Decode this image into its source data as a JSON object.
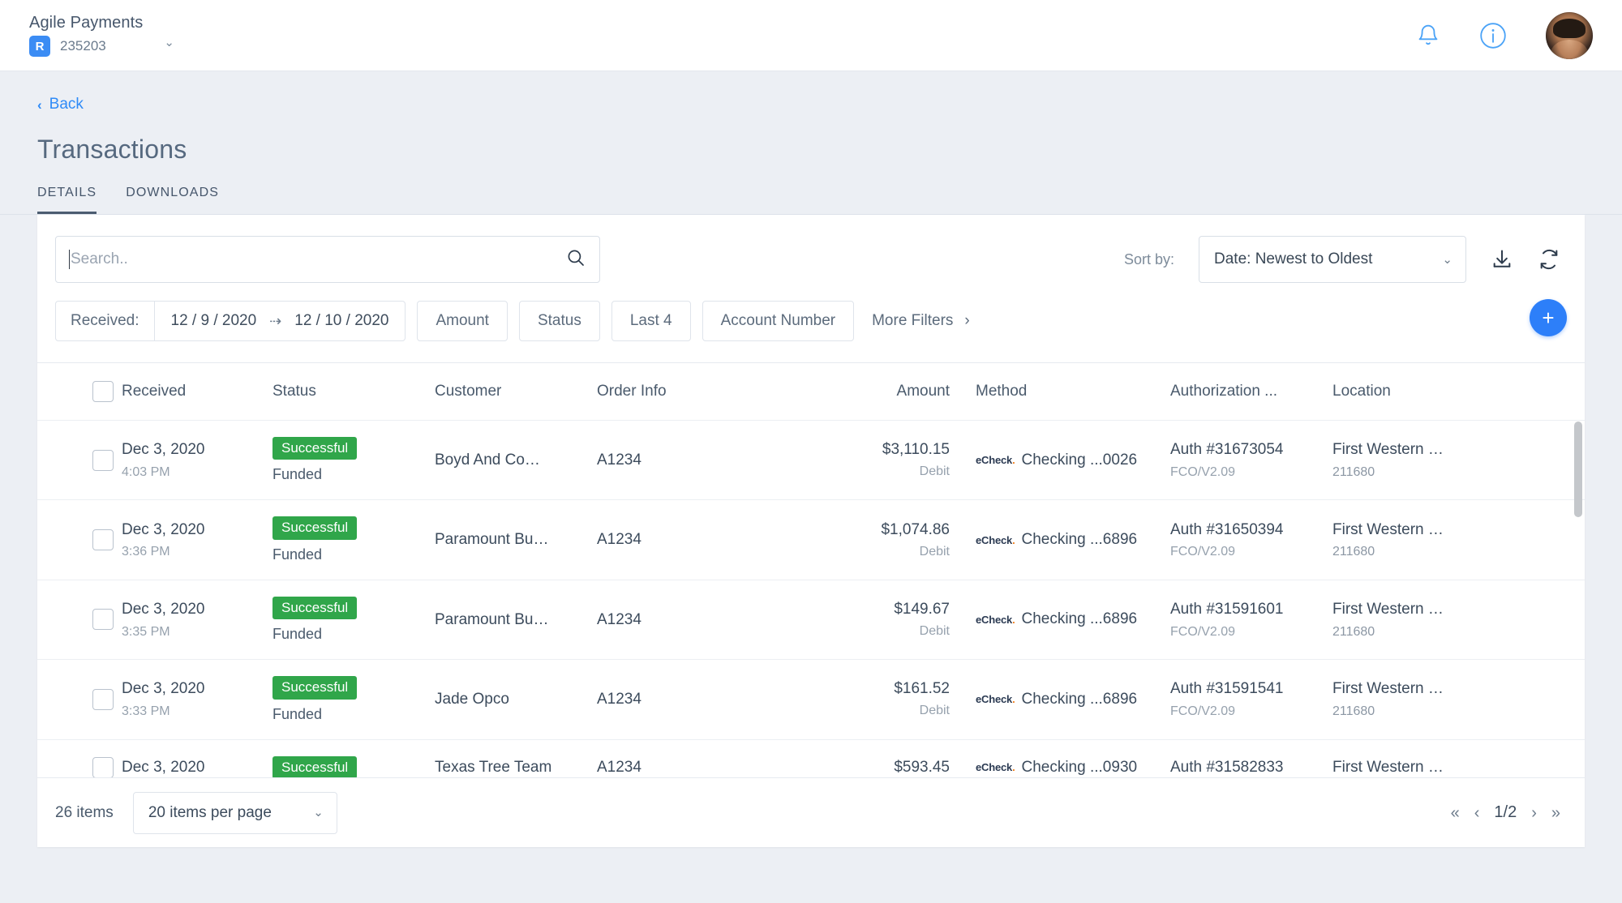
{
  "topbar": {
    "brand_name": "Agile Payments",
    "brand_badge": "R",
    "merchant_id": "235203",
    "caret": "⌄",
    "bell_icon": "bell-icon",
    "info_icon": "info-icon",
    "avatar": "user-avatar"
  },
  "page": {
    "back_label": "Back",
    "back_chevron": "‹",
    "title": "Transactions",
    "tabs": [
      {
        "label": "DETAILS",
        "active": true
      },
      {
        "label": "DOWNLOADS",
        "active": false
      }
    ]
  },
  "toolbar": {
    "search_placeholder": "Search..",
    "search_value": "",
    "search_icon": "search-icon",
    "sort_label": "Sort by:",
    "sort_value": "Date: Newest to Oldest",
    "sort_chevron": "⌄",
    "download_icon": "download-icon",
    "refresh_icon": "refresh-icon"
  },
  "filters": {
    "received_label": "Received:",
    "date_from": "12 / 9 / 2020",
    "date_arrow": "⇢",
    "date_to": "12 / 10 / 2020",
    "chips": [
      "Amount",
      "Status",
      "Last 4",
      "Account Number"
    ],
    "more_filters": "More Filters",
    "more_chevron": "›",
    "add_button": "+"
  },
  "table": {
    "columns": [
      "Received",
      "Status",
      "Customer",
      "Order Info",
      "Amount",
      "Method",
      "Authorization ...",
      "Location"
    ],
    "rows": [
      {
        "date": "Dec 3, 2020",
        "time": "4:03 PM",
        "status": "Successful",
        "status_sub": "Funded",
        "customer": "Boyd And Co…",
        "order": "A1234",
        "amount": "$3,110.15",
        "amount_type": "Debit",
        "method_brand": "eCheck",
        "method": "Checking ...0026",
        "auth": "Auth #31673054",
        "auth_sub": "FCO/V2.09",
        "location": "First Western …",
        "location_sub": "211680"
      },
      {
        "date": "Dec 3, 2020",
        "time": "3:36 PM",
        "status": "Successful",
        "status_sub": "Funded",
        "customer": "Paramount Bu…",
        "order": "A1234",
        "amount": "$1,074.86",
        "amount_type": "Debit",
        "method_brand": "eCheck",
        "method": "Checking ...6896",
        "auth": "Auth #31650394",
        "auth_sub": "FCO/V2.09",
        "location": "First Western …",
        "location_sub": "211680"
      },
      {
        "date": "Dec 3, 2020",
        "time": "3:35 PM",
        "status": "Successful",
        "status_sub": "Funded",
        "customer": "Paramount Bu…",
        "order": "A1234",
        "amount": "$149.67",
        "amount_type": "Debit",
        "method_brand": "eCheck",
        "method": "Checking ...6896",
        "auth": "Auth #31591601",
        "auth_sub": "FCO/V2.09",
        "location": "First Western …",
        "location_sub": "211680"
      },
      {
        "date": "Dec 3, 2020",
        "time": "3:33 PM",
        "status": "Successful",
        "status_sub": "Funded",
        "customer": "Jade Opco",
        "order": "A1234",
        "amount": "$161.52",
        "amount_type": "Debit",
        "method_brand": "eCheck",
        "method": "Checking ...6896",
        "auth": "Auth #31591541",
        "auth_sub": "FCO/V2.09",
        "location": "First Western …",
        "location_sub": "211680"
      },
      {
        "date": "Dec 3, 2020",
        "time": "",
        "status": "Successful",
        "status_sub": "",
        "customer": "Texas Tree Team",
        "order": "A1234",
        "amount": "$593.45",
        "amount_type": "",
        "method_brand": "eCheck",
        "method": "Checking ...0930",
        "auth": "Auth #31582833",
        "auth_sub": "",
        "location": "First Western …",
        "location_sub": ""
      }
    ]
  },
  "footer": {
    "items_count": "26 items",
    "per_page": "20 items per page",
    "per_page_chevron": "⌄",
    "first_page": "«",
    "prev_page": "‹",
    "page_indicator": "1/2",
    "next_page": "›",
    "last_page": "»"
  },
  "colors": {
    "accent": "#2d7ff9",
    "link": "#2f8bf7",
    "success": "#30a64a",
    "brand_badge": "#3b8cf4",
    "echeck_dot": "#f08020",
    "page_bg": "#eceff4"
  }
}
